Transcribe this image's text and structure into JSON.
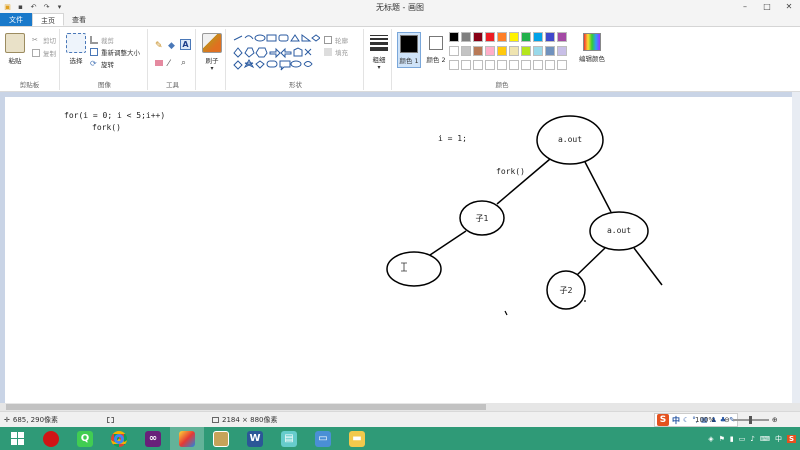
{
  "window": {
    "title": "无标题 - 画图",
    "qat_icons": [
      "paint-app-icon",
      "save-icon",
      "undo-icon",
      "redo-icon",
      "customize-icon"
    ],
    "controls": [
      "minimize-icon",
      "maximize-icon",
      "close-icon"
    ]
  },
  "tabs": [
    "文件",
    "主页",
    "查看"
  ],
  "ribbon": {
    "clipboard": {
      "paste": "粘贴",
      "cut": "剪切",
      "copy": "复制",
      "label": "剪贴板"
    },
    "image": {
      "select": "选择",
      "crop": "裁剪",
      "resize": "重新调整大小",
      "rotate": "旋转",
      "label": "图像"
    },
    "tools": {
      "label": "工具"
    },
    "brushes": {
      "label": "刷子"
    },
    "shapes": {
      "outline": "轮廓",
      "fill": "填充",
      "label": "形状"
    },
    "size": {
      "label": "粗细"
    },
    "colors": {
      "color1": "颜色 1",
      "color2": "颜色 2",
      "edit": "编辑颜色",
      "label": "颜色",
      "palette_row1": [
        "#000000",
        "#7f7f7f",
        "#880015",
        "#ed1c24",
        "#ff7f27",
        "#fff200",
        "#22b14c",
        "#00a2e8",
        "#3f48cc",
        "#a349a4"
      ],
      "palette_row2": [
        "#ffffff",
        "#c3c3c3",
        "#b97a57",
        "#ffaec9",
        "#ffc90e",
        "#efe4b0",
        "#b5e61d",
        "#99d9ea",
        "#7092be",
        "#c8bfe7"
      ],
      "primary": "#000000",
      "secondary": "#ffffff"
    }
  },
  "canvas": {
    "code_line1": "for(i = 0; i < 5;i++)",
    "code_line2": "fork()",
    "var_text": "i = 1;",
    "fork_label": "fork()",
    "nodes": {
      "root": "a.out",
      "child1": "子1",
      "right": "a.out",
      "child2": "子2",
      "empty": ""
    }
  },
  "status": {
    "cursor_pos": "685, 290像素",
    "canvas_size": "2184 × 880像素",
    "zoom": "100%"
  },
  "ime": {
    "mode": "中"
  },
  "taskbar": {
    "apps": [
      "start-icon",
      "record-app-icon",
      "qt-creator-icon",
      "chrome-icon",
      "visual-studio-icon",
      "paint-icon",
      "photo-viewer-icon",
      "word-icon",
      "notes-icon",
      "screen-tool-icon",
      "file-explorer-icon"
    ],
    "tray_lang": "中"
  }
}
